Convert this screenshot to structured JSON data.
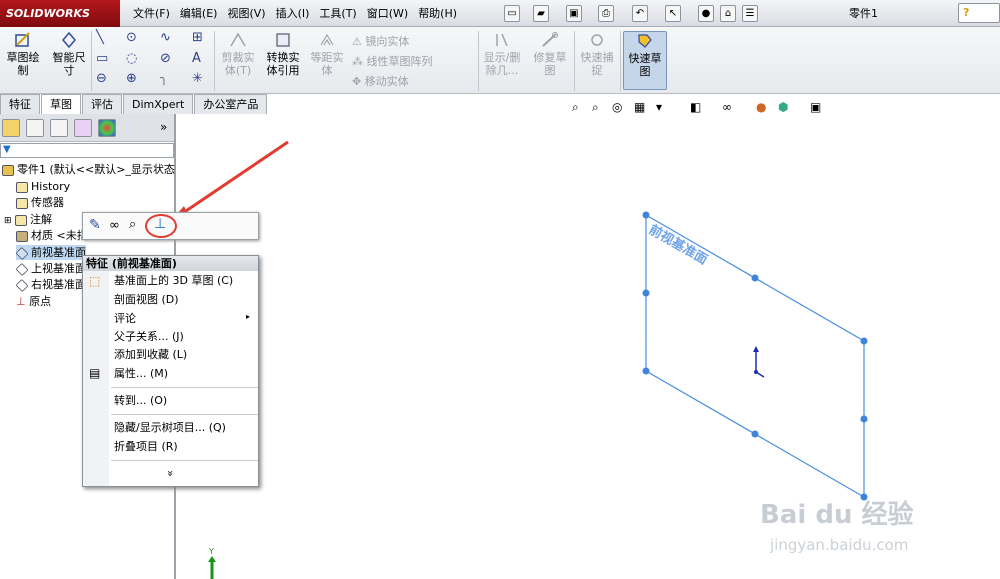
{
  "app": {
    "logo": "SOLIDWORKS",
    "doc_title": "零件1"
  },
  "menus": [
    "文件(F)",
    "编辑(E)",
    "视图(V)",
    "插入(I)",
    "工具(T)",
    "窗口(W)",
    "帮助(H)"
  ],
  "ribbon": {
    "sketch": "草图绘制",
    "smart_dim": "智能尺寸",
    "trim": "剪裁实体(T)",
    "convert": "转换实体引用",
    "offset": "等距实体",
    "mirror": "镜向实体",
    "linear_pattern": "线性草图阵列",
    "move": "移动实体",
    "display_delete": "显示/删除几...",
    "repair": "修复草图",
    "quick_snap": "快速捕捉",
    "rapid_sketch": "快速草图"
  },
  "tabs": [
    "特征",
    "草图",
    "评估",
    "DimXpert",
    "办公室产品"
  ],
  "active_tab": "草图",
  "tree": {
    "root": "零件1 (默认<<默认>_显示状态",
    "items": [
      "History",
      "传感器",
      "注解",
      "材质 <未指",
      "前视基准面",
      "上视基准面",
      "右视基准面",
      "原点"
    ]
  },
  "context_menu": {
    "title": "特征 (前视基准面)",
    "items": [
      "基准面上的 3D 草图 (C)",
      "剖面视图 (D)",
      "评论",
      "父子关系... (J)",
      "添加到收藏 (L)",
      "属性... (M)",
      "转到... (O)",
      "隐藏/显示树项目... (Q)",
      "折叠项目 (R)"
    ],
    "more": "»"
  },
  "viewport": {
    "plane_label": "前视基准面",
    "axis_label": "Y"
  },
  "watermark": {
    "brand": "Bai du 经验",
    "url": "jingyan.baidu.com"
  },
  "colors": {
    "plane": "#4a8fe0",
    "accent": "#e23b30",
    "logo_bg": "#a5141a"
  }
}
